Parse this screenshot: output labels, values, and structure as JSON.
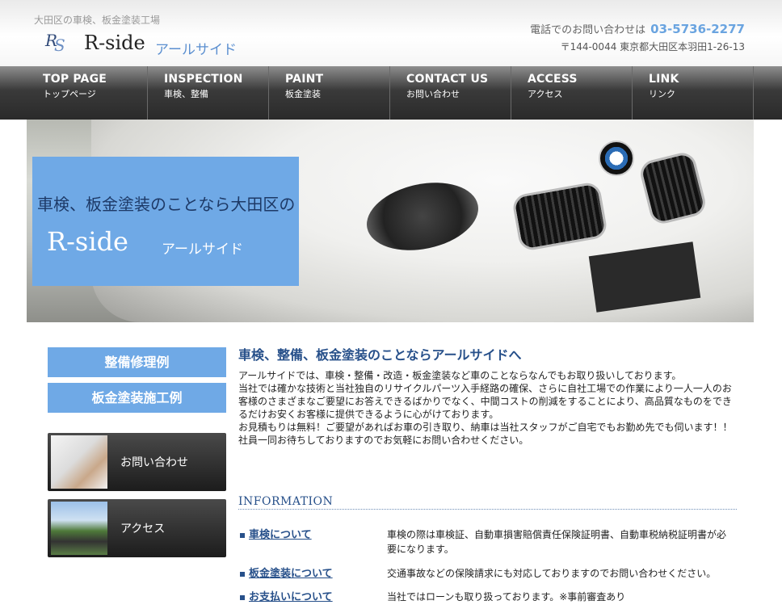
{
  "header": {
    "tagline": "大田区の車検、板金塗装工場",
    "logo_mark_r": "R",
    "logo_mark_s": "S",
    "logo_name": "R-side",
    "logo_kana": "アールサイド",
    "phone_label": "電話でのお問い合わせは",
    "phone_number": "03-5736-2277",
    "address": "〒144-0044 東京都大田区本羽田1-26-13"
  },
  "nav": {
    "items": [
      {
        "en": "TOP PAGE",
        "jp": "トップページ"
      },
      {
        "en": "INSPECTION",
        "jp": "車検、整備"
      },
      {
        "en": "PAINT",
        "jp": "板金塗装"
      },
      {
        "en": "CONTACT US",
        "jp": "お問い合わせ"
      },
      {
        "en": "ACCESS",
        "jp": "アクセス"
      },
      {
        "en": "LINK",
        "jp": "リンク"
      }
    ]
  },
  "hero": {
    "line1": "車検、板金塗装のことなら大田区の",
    "name": "R-side",
    "kana": "アールサイド"
  },
  "sidebar": {
    "buttons": [
      "整備修理例",
      "板金塗装施工例"
    ],
    "cards": [
      {
        "label": "お問い合わせ",
        "thumb_icon": "handshake-photo"
      },
      {
        "label": "アクセス",
        "thumb_icon": "road-photo"
      }
    ]
  },
  "content": {
    "title": "車検、整備、板金塗装のことならアールサイドへ",
    "intro": [
      "アールサイドでは、車検・整備・改造・板金塗装など車のことならなんでもお取り扱いしております。",
      "当社では確かな技術と当社独自のリサイクルパーツ入手経路の確保、さらに自社工場での作業により一人一人のお客様のさまざまなご要望にお答えできるばかりでなく、中間コストの削減をすることにより、高品質なものをできるだけお安くお客様に提供できるように心がけております。",
      "お見積もりは無料！ご要望があればお車の引き取り、納車は当社スタッフがご自宅でもお勤め先でも伺います！！",
      "社員一同お待ちしておりますのでお気軽にお問い合わせください。"
    ]
  },
  "information": {
    "heading": "INFORMATION",
    "rows": [
      {
        "key": "車検について",
        "value": "車検の際は車検証、自動車損害賠償責任保険証明書、自動車税納税証明書が必要になります。"
      },
      {
        "key": "板金塗装について",
        "value": "交通事故などの保険請求にも対応しておりますのでお問い合わせください。"
      },
      {
        "key": "お支払いについて",
        "value": "当社ではローンも取り扱っております。※事前審査あり"
      }
    ]
  },
  "colors": {
    "accent_blue": "#6fa9e6",
    "heading_blue": "#27508a",
    "nav_dark": "#2a2a2a"
  }
}
